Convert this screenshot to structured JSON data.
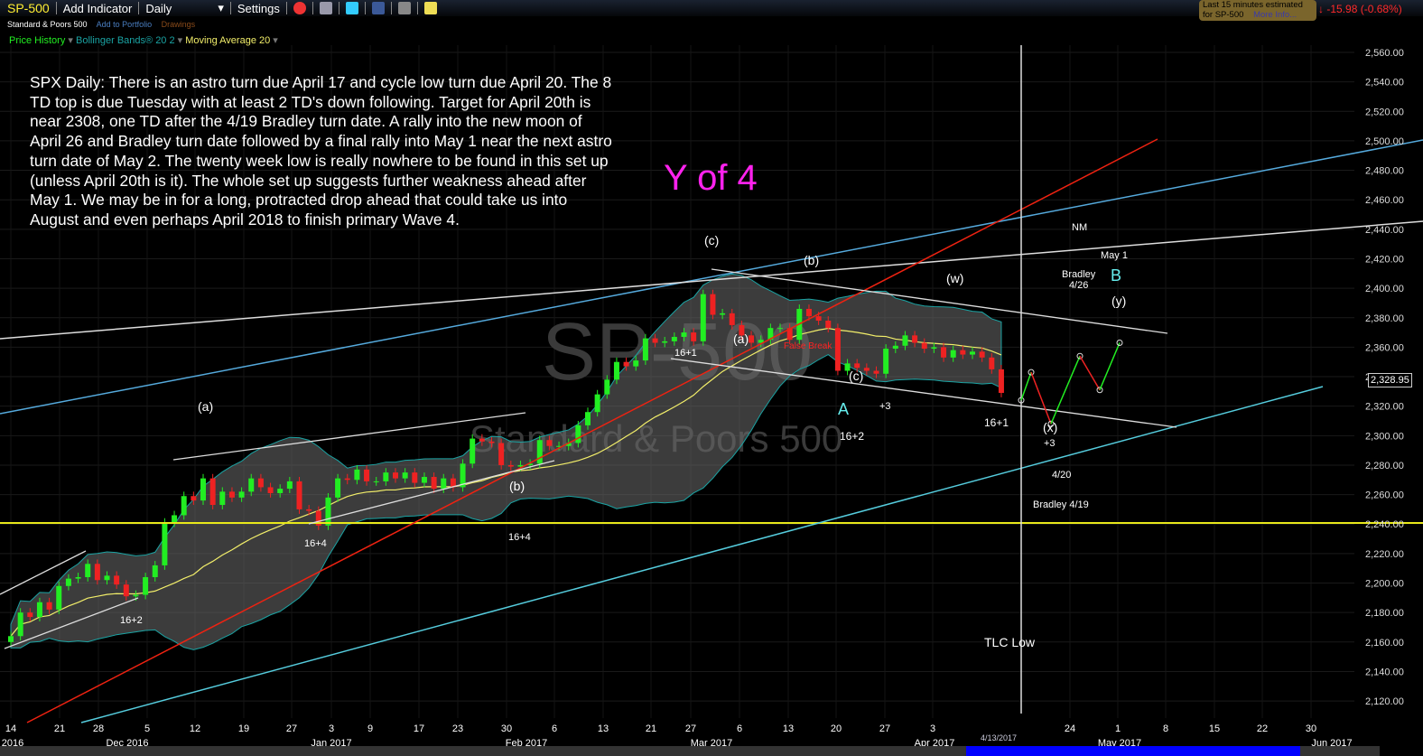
{
  "toolbar": {
    "symbol": "SP-500",
    "add_indicator": "Add Indicator",
    "interval": "Daily",
    "settings": "Settings"
  },
  "subbar": {
    "name": "Standard & Poors 500",
    "add_portfolio": "Add to Portfolio",
    "drawings": "Drawings"
  },
  "indicators": [
    {
      "label": "Price History",
      "color": "#22ee22"
    },
    {
      "label": "Bollinger Bands® 20 2",
      "color": "#1aa3a3"
    },
    {
      "label": "Moving Average 20",
      "color": "#f2ee6a"
    }
  ],
  "quote": {
    "line1": "Last 15 minutes estimated",
    "line2": "for SP-500",
    "more": "More Info...",
    "change": "-15.98 (-0.68%)"
  },
  "last_price": "2,328.95",
  "commentary": "SPX Daily: There is an astro turn due April 17 and cycle low turn due April 20.  The 8 TD top is due Tuesday with at least 2 TD's down following.  Target for April 20th is near 2308, one TD after the 4/19 Bradley turn date. A rally into the new moon of April 26 and Bradley turn date followed by a final rally into May 1 near the next astro turn date of May 2. The twenty week low is really nowhere to be found in this set up (unless April 20th is it).  The whole set up suggests further weakness ahead after May 1.  We may be in for a long, protracted drop ahead that could take us into August and even perhaps April 2018 to finish primary Wave 4.",
  "annotations": {
    "y_of_4": "Y of 4",
    "c_top": "(c)",
    "b_top": "(b)",
    "w": "(w)",
    "nm": "NM",
    "may1": "May 1",
    "bradley426": "Bradley\n4/26",
    "B": "B",
    "y": "(y)",
    "a_mid": "(a)",
    "false_break": "False Break",
    "n16p1a": "16+1",
    "c_low": "(c)",
    "p3a": "+3",
    "A": "A",
    "n16p2a": "16+2",
    "n16p1b": "16+1",
    "x": "(x)",
    "p3b": "+3",
    "d420": "4/20",
    "bradley419": "Bradley 4/19",
    "n16p4a": "16+4",
    "n16p4b": "16+4",
    "a_left": "(a)",
    "b_left": "(b)",
    "n16p2b": "16+2",
    "tlc": "TLC Low",
    "cursor_date": "4/13/2017"
  },
  "watermark": {
    "symbol": "SP-500",
    "name": "Standard & Poors 500"
  },
  "chart_data": {
    "type": "candlestick",
    "title": "SP-500 Daily",
    "ylim": [
      2110,
      2570
    ],
    "y_ticks": [
      2120,
      2140,
      2160,
      2180,
      2200,
      2220,
      2240,
      2260,
      2280,
      2300,
      2320,
      2340,
      2360,
      2380,
      2400,
      2420,
      2440,
      2460,
      2480,
      2500,
      2520,
      2540,
      2560
    ],
    "x_day_labels": [
      "14",
      "21",
      "28",
      "5",
      "12",
      "19",
      "27",
      "3",
      "9",
      "17",
      "23",
      "30",
      "6",
      "13",
      "21",
      "27",
      "6",
      "13",
      "20",
      "27",
      "3",
      "24",
      "1",
      "8",
      "15",
      "22",
      "30"
    ],
    "x_month_labels": [
      "2016",
      "Dec 2016",
      "Jan 2017",
      "Feb 2017",
      "Mar 2017",
      "Apr 2017",
      "May 2017",
      "Jun 2017"
    ],
    "first_date": "2016-11-14",
    "last_date": "2017-04-13",
    "closes": [
      2164,
      2180,
      2177,
      2187,
      2182,
      2198,
      2203,
      2204,
      2213,
      2202,
      2205,
      2199,
      2191,
      2192,
      2204,
      2212,
      2241,
      2246,
      2259,
      2256,
      2271,
      2253,
      2262,
      2258,
      2262,
      2271,
      2265,
      2261,
      2264,
      2269,
      2250,
      2249,
      2239,
      2258,
      2271,
      2270,
      2277,
      2269,
      2269,
      2275,
      2271,
      2275,
      2268,
      2272,
      2264,
      2271,
      2265,
      2281,
      2298,
      2296,
      2295,
      2280,
      2279,
      2280,
      2281,
      2297,
      2293,
      2293,
      2295,
      2307,
      2316,
      2328,
      2338,
      2350,
      2347,
      2351,
      2366,
      2363,
      2364,
      2367,
      2370,
      2364,
      2396,
      2382,
      2383,
      2375,
      2368,
      2363,
      2365,
      2373,
      2373,
      2365,
      2386,
      2381,
      2378,
      2373,
      2344,
      2349,
      2346,
      2344,
      2342,
      2359,
      2361,
      2368,
      2363,
      2359,
      2360,
      2353,
      2358,
      2355,
      2357,
      2353,
      2345,
      2329
    ],
    "bollinger": {
      "period": 20,
      "stddev": 2
    },
    "moving_average": {
      "period": 20
    },
    "horizontal_line": 2233,
    "projection": [
      2324,
      2343,
      2308,
      2354,
      2331,
      2363
    ]
  }
}
